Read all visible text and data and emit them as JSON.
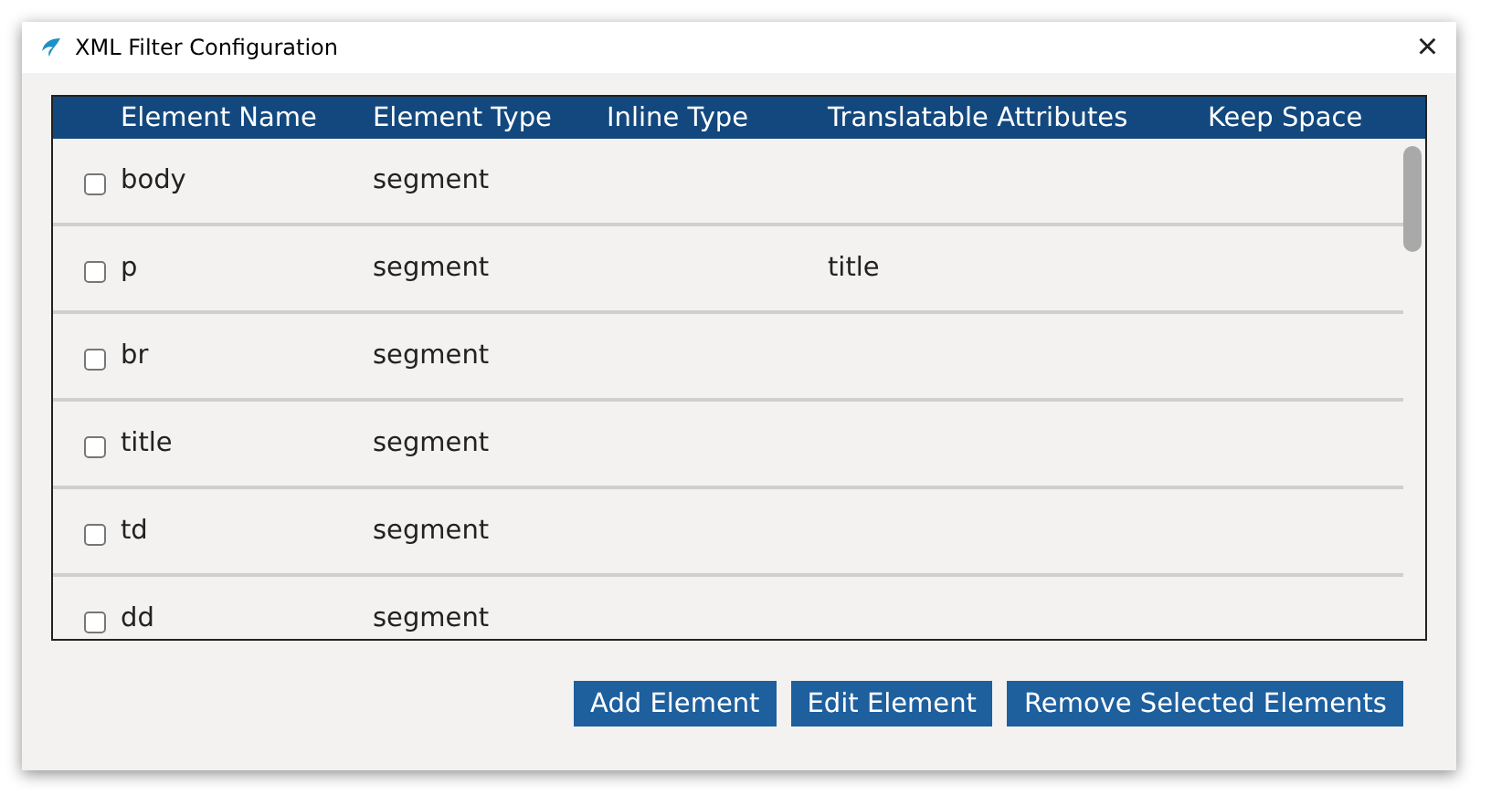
{
  "window": {
    "title": "XML Filter Configuration",
    "close": "×"
  },
  "table": {
    "columns": [
      "Element Name",
      "Element Type",
      "Inline Type",
      "Translatable Attributes",
      "Keep Space"
    ],
    "rows": [
      {
        "checked": false,
        "cells": [
          "body",
          "segment",
          "",
          "",
          ""
        ]
      },
      {
        "checked": false,
        "cells": [
          "p",
          "segment",
          "",
          "title",
          ""
        ]
      },
      {
        "checked": false,
        "cells": [
          "br",
          "segment",
          "",
          "",
          ""
        ]
      },
      {
        "checked": false,
        "cells": [
          "title",
          "segment",
          "",
          "",
          ""
        ]
      },
      {
        "checked": false,
        "cells": [
          "td",
          "segment",
          "",
          "",
          ""
        ]
      },
      {
        "checked": false,
        "cells": [
          "dd",
          "segment",
          "",
          "",
          ""
        ]
      }
    ]
  },
  "buttons": [
    "Add Element",
    "Edit Element",
    "Remove Selected Elements"
  ]
}
